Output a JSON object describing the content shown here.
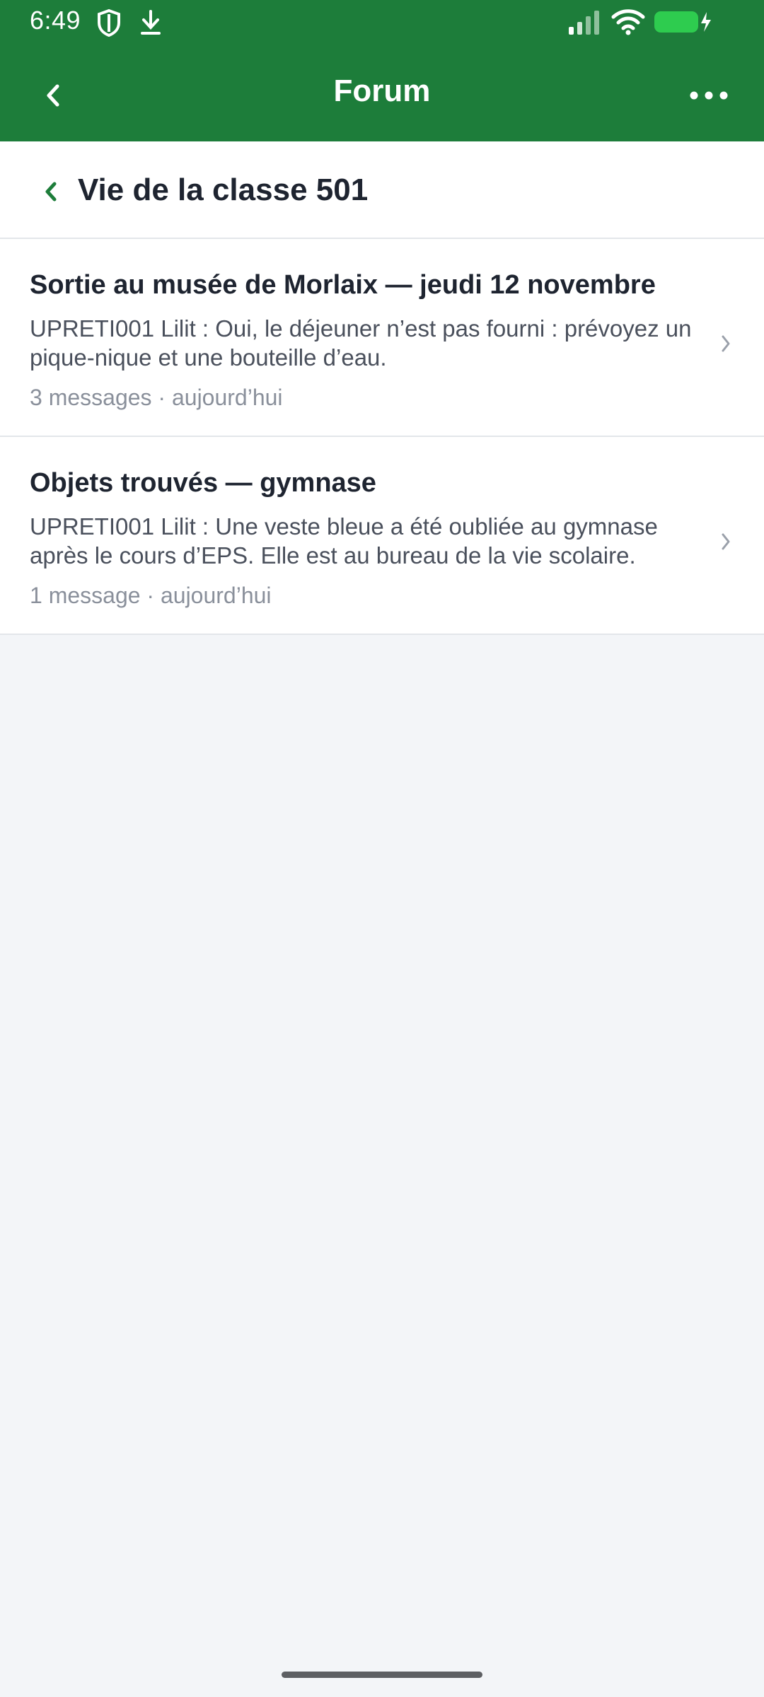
{
  "status_bar": {
    "time": "6:49",
    "icons": [
      "shield-icon",
      "download-icon",
      "signal-icon",
      "wifi-icon",
      "battery-charging-icon"
    ]
  },
  "app_bar": {
    "title": "Forum",
    "back_icon": "chevron-left-icon",
    "more_icon": "more-horizontal-icon"
  },
  "section": {
    "title": "Vie de la classe 501"
  },
  "topics": [
    {
      "title": "Sortie au musée de Morlaix — jeudi 12 novembre",
      "preview": "UPRETI001 Lilit : Oui, le déjeuner n’est pas fourni : prévoyez un pique-nique et une bouteille d’eau.",
      "meta": "3 messages · aujourd’hui"
    },
    {
      "title": "Objets trouvés — gymnase",
      "preview": "UPRETI001 Lilit : Une veste bleue a été oubliée au gymnase après le cours d’EPS. Elle est au bureau de la vie scolaire.",
      "meta": "1 message · aujourd’hui"
    }
  ],
  "colors": {
    "header_green": "#1d7d3a",
    "accent_green": "#1d7d3a",
    "background": "#f3f5f8"
  }
}
